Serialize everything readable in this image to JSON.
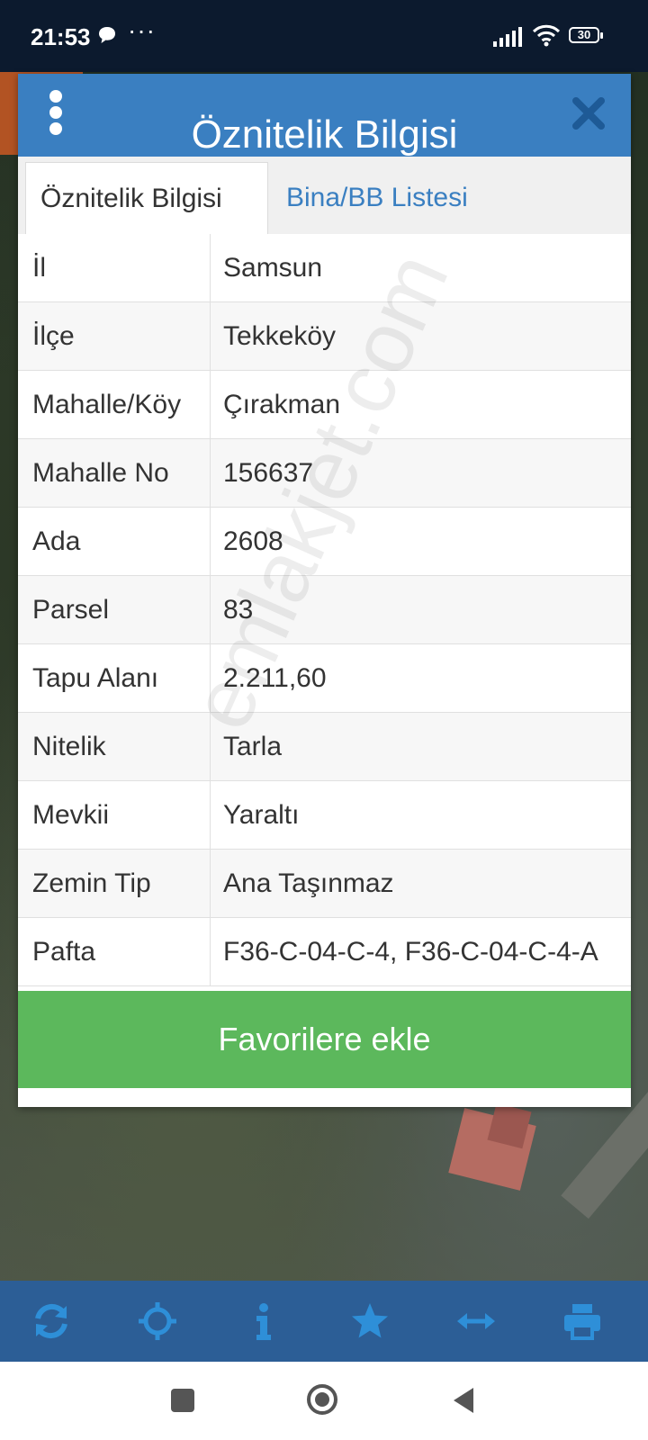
{
  "status_bar": {
    "time": "21:53",
    "battery_level": "30",
    "icons": [
      "message-icon",
      "more-dots-icon",
      "signal-icon",
      "wifi-icon",
      "battery-icon"
    ],
    "dots": "···"
  },
  "dialog": {
    "title": "Öznitelik Bilgisi",
    "tabs": [
      {
        "label": "Öznitelik Bilgisi",
        "active": true
      },
      {
        "label": "Bina/BB Listesi",
        "active": false
      }
    ],
    "rows": [
      {
        "key": "İl",
        "value": "Samsun"
      },
      {
        "key": "İlçe",
        "value": "Tekkeköy"
      },
      {
        "key": "Mahalle/Köy",
        "value": "Çırakman"
      },
      {
        "key": "Mahalle No",
        "value": "156637"
      },
      {
        "key": "Ada",
        "value": "2608"
      },
      {
        "key": "Parsel",
        "value": "83"
      },
      {
        "key": "Tapu Alanı",
        "value": "2.211,60"
      },
      {
        "key": "Nitelik",
        "value": "Tarla"
      },
      {
        "key": "Mevkii",
        "value": "Yaraltı"
      },
      {
        "key": "Zemin Tip",
        "value": "Ana Taşınmaz"
      },
      {
        "key": "Pafta",
        "value": "F36-C-04-C-4, F36-C-04-C-4-A"
      }
    ],
    "favorite_button": "Favorilere ekle",
    "watermark": "emlakjet.com"
  },
  "toolbar": {
    "icons": [
      "refresh-icon",
      "locate-icon",
      "info-icon",
      "star-icon",
      "measure-icon",
      "print-icon"
    ]
  },
  "colors": {
    "header": "#3a7fc1",
    "button": "#5cb85c",
    "toolbar": "#2c5e96",
    "status_bar": "#0c1a2e"
  }
}
